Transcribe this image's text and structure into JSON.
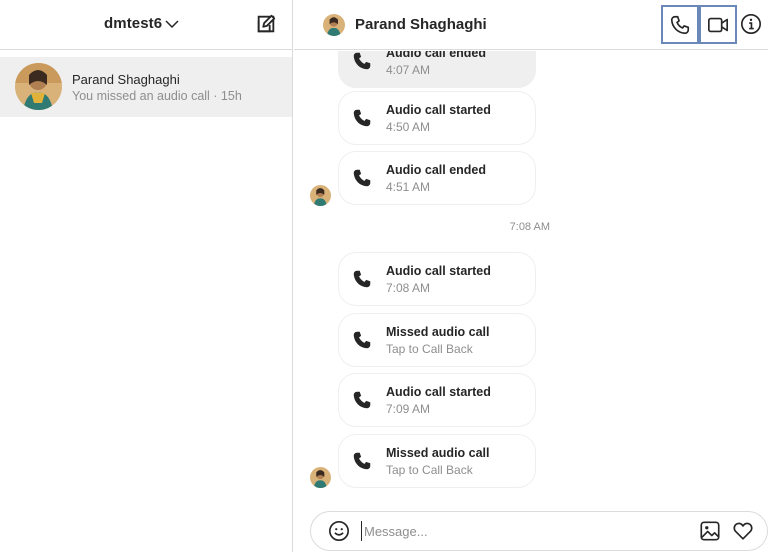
{
  "sidebar": {
    "account_name": "dmtest6",
    "threads": [
      {
        "name": "Parand Shaghaghi",
        "preview": "You missed an audio call · 15h"
      }
    ]
  },
  "chat": {
    "contact_name": "Parand Shaghaghi",
    "time_separator": "7:08 AM",
    "messages": [
      {
        "title": "Audio call ended",
        "sub": "4:07 AM"
      },
      {
        "title": "Audio call started",
        "sub": "4:50 AM"
      },
      {
        "title": "Audio call ended",
        "sub": "4:51 AM"
      },
      {
        "title": "Audio call started",
        "sub": "7:08 AM"
      },
      {
        "title": "Missed audio call",
        "sub": "Tap to Call Back"
      },
      {
        "title": "Audio call started",
        "sub": "7:09 AM"
      },
      {
        "title": "Missed audio call",
        "sub": "Tap to Call Back"
      }
    ]
  },
  "composer": {
    "placeholder": "Message..."
  },
  "icons": {
    "chevron": "chevron-down-icon",
    "compose": "new-message-icon",
    "phone": "phone-icon",
    "video": "video-camera-icon",
    "info": "info-icon",
    "emoji": "emoji-icon",
    "image": "image-icon",
    "heart": "heart-icon"
  },
  "colors": {
    "highlight_border": "#6b89b8",
    "selected_thread": "#efefef",
    "divider": "#dbdbdb"
  }
}
